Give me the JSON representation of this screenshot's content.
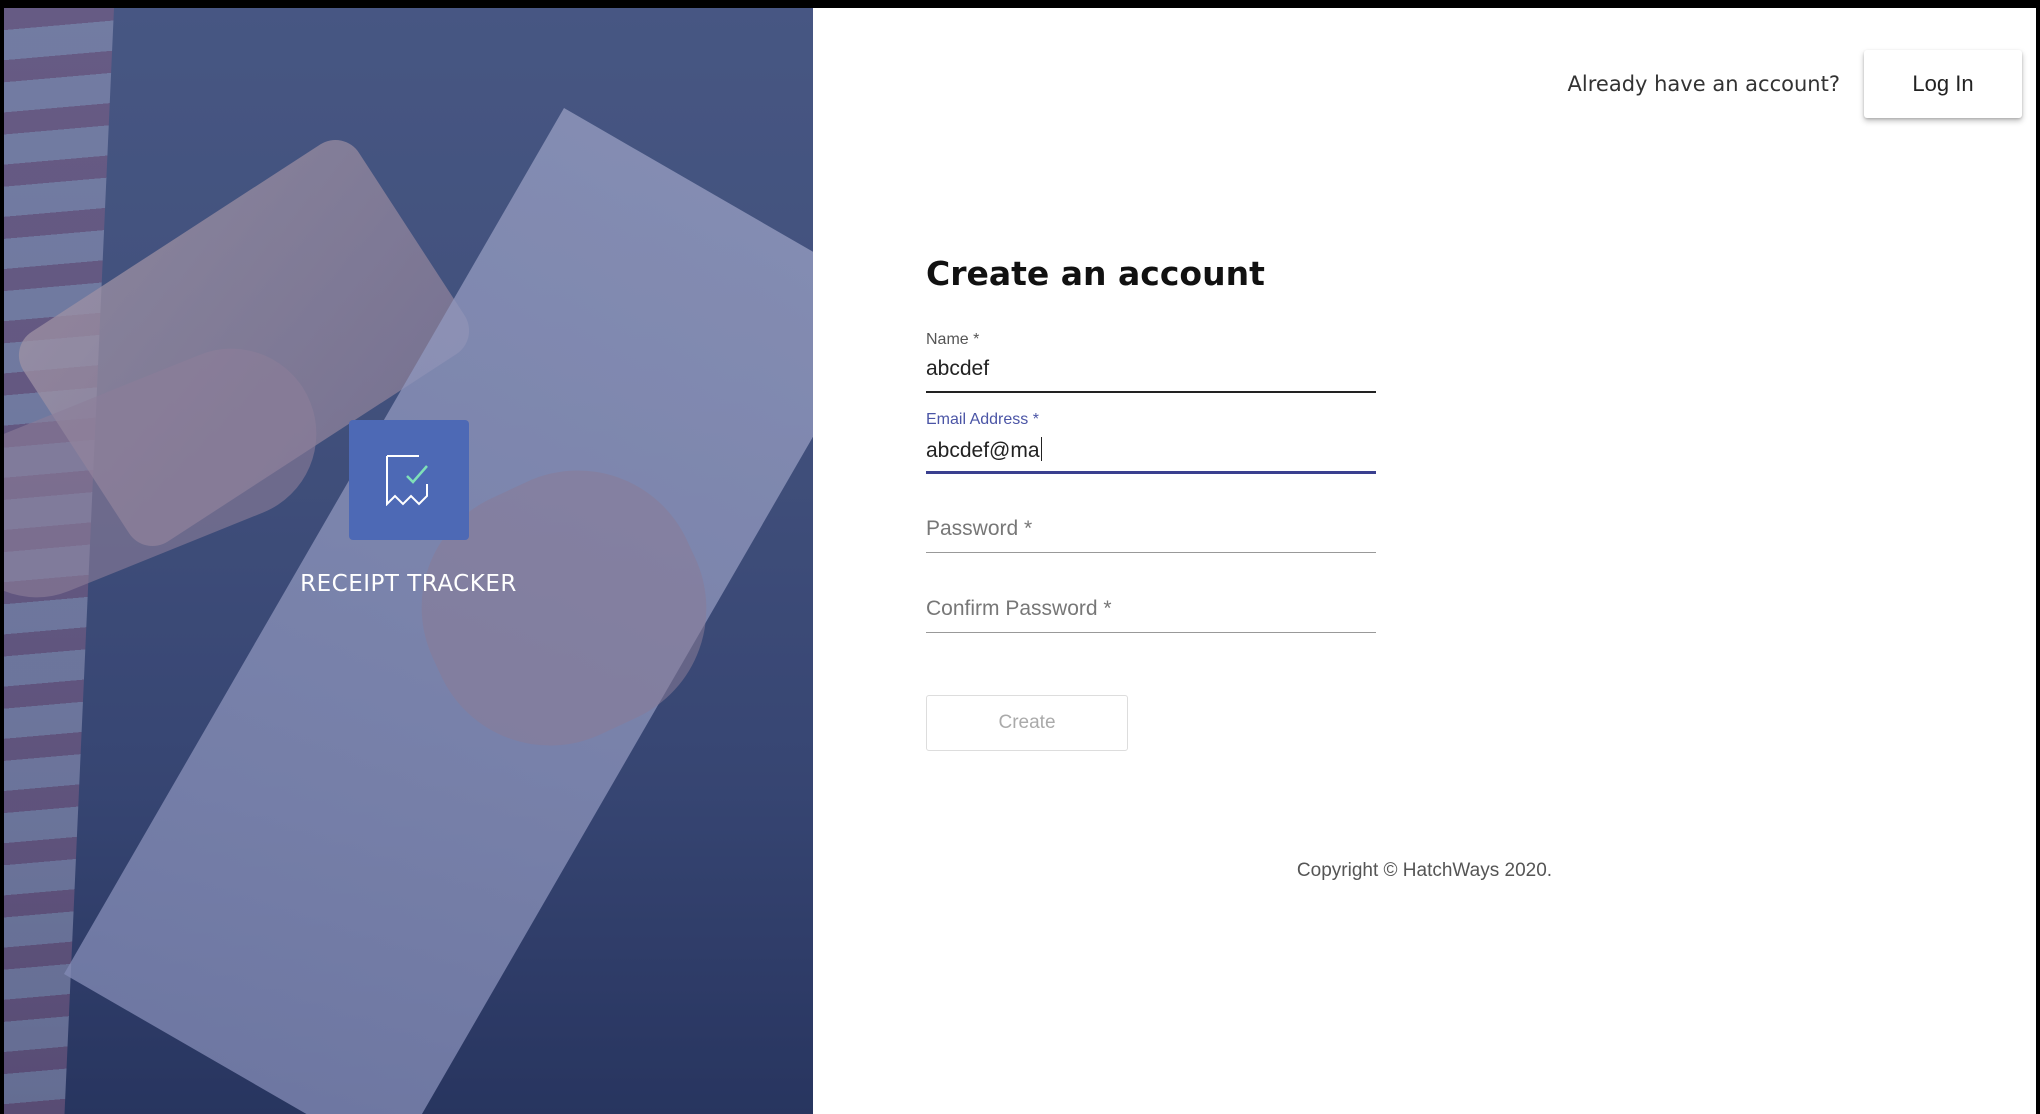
{
  "brand": {
    "name": "RECEIPT TRACKER",
    "logo_icon": "receipt-check-icon",
    "logo_color": "#4d69b5"
  },
  "header": {
    "prompt": "Already have an account?",
    "login_label": "Log In"
  },
  "form": {
    "title": "Create an account",
    "name": {
      "label": "Name *",
      "value": "abcdef"
    },
    "email": {
      "label": "Email Address *",
      "value": "abcdef@ma",
      "focused": true
    },
    "password": {
      "placeholder": "Password *"
    },
    "confirm_password": {
      "placeholder": "Confirm Password *"
    },
    "create_label": "Create"
  },
  "footer": {
    "copyright": "Copyright © HatchWays 2020."
  },
  "colors": {
    "accent": "#4b55a6",
    "focus_underline": "#3a3f8f"
  }
}
